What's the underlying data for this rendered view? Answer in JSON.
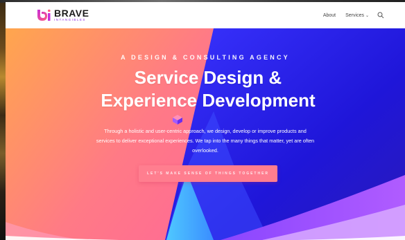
{
  "brand": {
    "name": "BRAVE",
    "subtitle": "INTANGIBLES",
    "colors": {
      "mark_start": "#c72fd9",
      "mark_end": "#ff5a7a",
      "accent": "#8a2be2"
    }
  },
  "nav": {
    "items": [
      {
        "label": "About"
      },
      {
        "label": "Services",
        "chevron": "chevron-down-icon"
      }
    ],
    "search_icon": "search-icon"
  },
  "hero": {
    "tagline": "A DESIGN & CONSULTING AGENCY",
    "headline_line1": "Service Design &",
    "headline_line2": "Experience Development",
    "body_line1": "Through a holistic and user-centric approach, we design, develop or improve products and",
    "body_line2": "services to deliver exceptional experiences. We tap into the many things that matter, yet are often",
    "body_line3": "overlooked.",
    "cta_label": "LET'S MAKE SENSE OF THINGS TOGETHER",
    "colors": {
      "warm_start": "#ffb347",
      "warm_mid": "#ff6f91",
      "cool_blue": "#2a2df5",
      "deep_blue": "#1a14d8",
      "violet": "#8b2be2",
      "cyan": "#38b6ff",
      "cta": "#ff7e8f"
    }
  }
}
